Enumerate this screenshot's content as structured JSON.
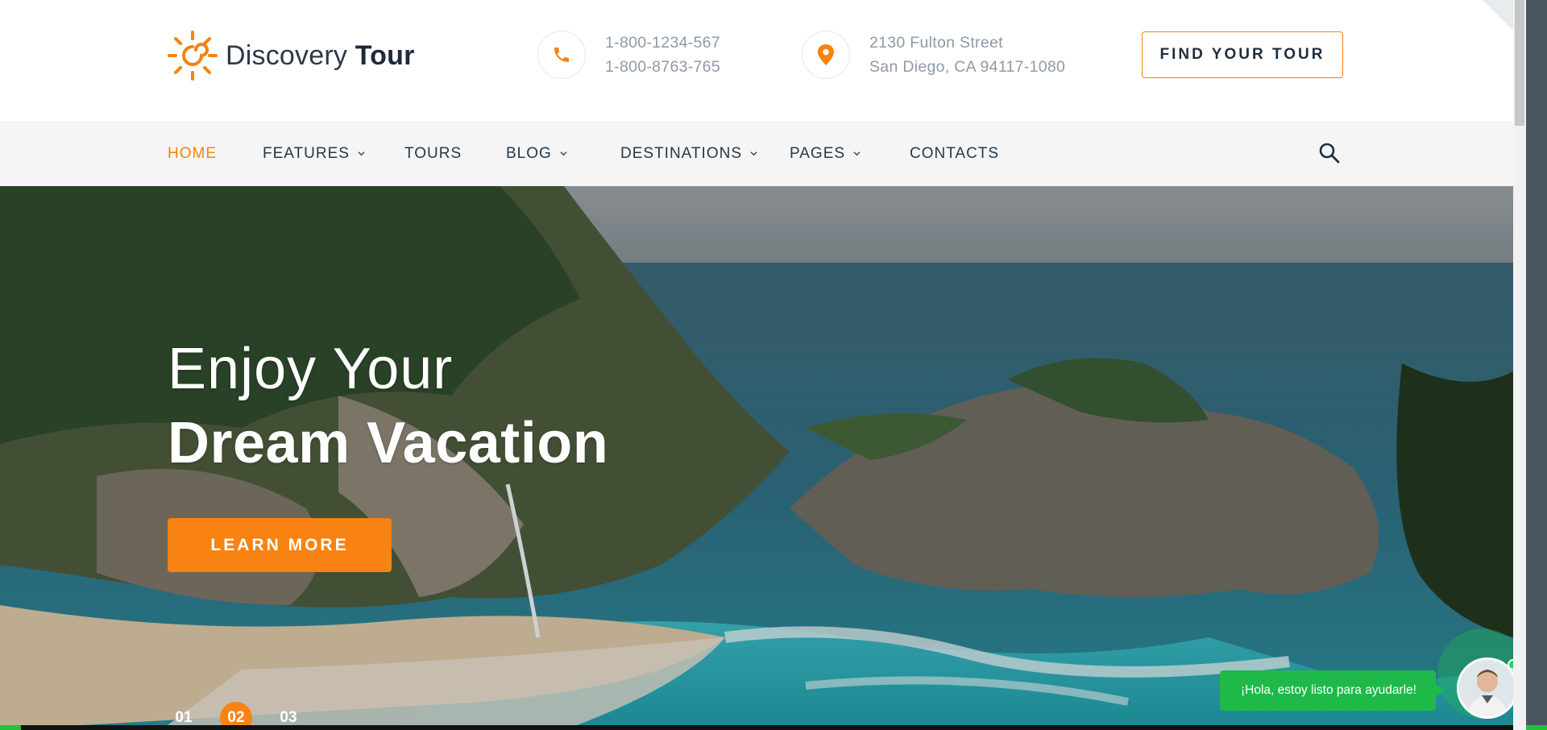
{
  "brand": {
    "name_light": "Discovery",
    "name_bold": "Tour"
  },
  "contacts": {
    "phone_1": "1-800-1234-567",
    "phone_2": "1-800-8763-765",
    "address_1": "2130 Fulton Street",
    "address_2": "San Diego, CA 94117-1080"
  },
  "header": {
    "find_tour_label": "FIND YOUR TOUR"
  },
  "nav": {
    "items": [
      {
        "label": "HOME"
      },
      {
        "label": "FEATURES"
      },
      {
        "label": "TOURS"
      },
      {
        "label": "BLOG"
      },
      {
        "label": "DESTINATIONS"
      },
      {
        "label": "PAGES"
      },
      {
        "label": "CONTACTS"
      }
    ]
  },
  "hero": {
    "title_line1": "Enjoy Your",
    "title_line2": "Dream Vacation",
    "cta_label": "LEARN MORE",
    "slides": [
      "01",
      "02",
      "03"
    ],
    "active_slide": "02"
  },
  "chat": {
    "message": "¡Hola, estoy listo para ayudarle!"
  },
  "colors": {
    "accent": "#f98312",
    "nav_bg": "#f5f5f5",
    "chat_green": "#1fb94a",
    "text_dark": "#25384a"
  },
  "icons": {
    "phone": "phone-icon",
    "location": "location-pin-icon",
    "search": "search-icon",
    "chevron": "chevron-down-icon"
  }
}
